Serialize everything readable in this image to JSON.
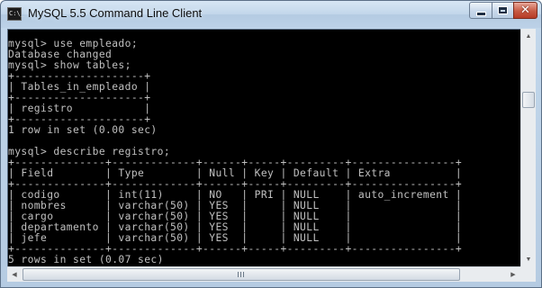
{
  "window": {
    "title": "MySQL 5.5 Command Line Client",
    "icon": "console-icon",
    "icon_text": "C:\\_"
  },
  "controls": {
    "minimize": "minimize-icon",
    "maximize": "maximize-icon",
    "close": "close-icon",
    "close_glyph": "✕"
  },
  "console": {
    "background": "#000000",
    "text_color": "#c0c0c0",
    "lines": [
      "mysql> use empleado;",
      "Database changed",
      "mysql> show tables;",
      "+--------------------+",
      "| Tables_in_empleado |",
      "+--------------------+",
      "| registro           |",
      "+--------------------+",
      "1 row in set (0.00 sec)",
      "",
      "mysql> describe registro;",
      "+--------------+-------------+------+-----+---------+----------------+",
      "| Field        | Type        | Null | Key | Default | Extra          |",
      "+--------------+-------------+------+-----+---------+----------------+",
      "| codigo       | int(11)     | NO   | PRI | NULL    | auto_increment |",
      "| nombres      | varchar(50) | YES  |     | NULL    |                |",
      "| cargo        | varchar(50) | YES  |     | NULL    |                |",
      "| departamento | varchar(50) | YES  |     | NULL    |                |",
      "| jefe         | varchar(50) | YES  |     | NULL    |                |",
      "+--------------+-------------+------+-----+---------+----------------+",
      "5 rows in set (0.07 sec)"
    ]
  },
  "scrollbars": {
    "up_arrow": "▲",
    "down_arrow": "▼",
    "left_arrow": "◀",
    "right_arrow": "▶"
  }
}
